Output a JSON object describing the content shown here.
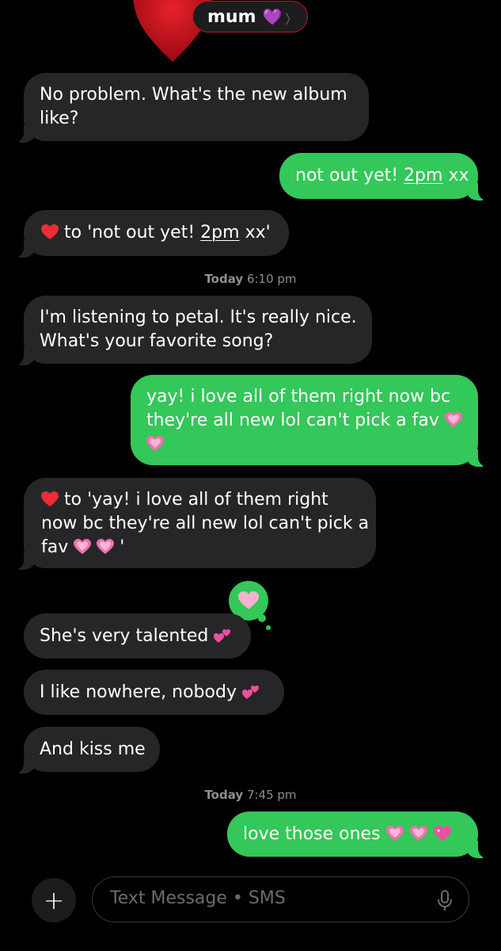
{
  "header": {
    "contact_name": "mum",
    "contact_emoji": "💜",
    "chevron": "〉"
  },
  "messages": [
    {
      "id": "m1",
      "text": "No problem.  What's the new album"
    },
    {
      "id": "m1b",
      "text": "like?"
    },
    {
      "id": "m2",
      "pre": "not out yet! ",
      "link": "2pm",
      "post": " xx"
    },
    {
      "id": "m3",
      "pre": " to 'not out yet! ",
      "link": "2pm",
      "post": " xx'"
    },
    {
      "id": "m4",
      "text": "I'm listening to petal. It's really nice."
    },
    {
      "id": "m4b",
      "text": "What's your favorite song?"
    },
    {
      "id": "m5",
      "text": "yay! i love all of them right now bc"
    },
    {
      "id": "m5b",
      "text": "they're all new lol can't pick a fav"
    },
    {
      "id": "m6",
      "text": " to 'yay! i love all of them right"
    },
    {
      "id": "m6b",
      "text": "now bc they're all new lol can't pick a"
    },
    {
      "id": "m6c",
      "text": "fav"
    },
    {
      "id": "m6d",
      "text": "'"
    },
    {
      "id": "m7",
      "text": "She's very talented"
    },
    {
      "id": "m8",
      "text": "I like nowhere,  nobody"
    },
    {
      "id": "m9",
      "text": "And kiss me"
    },
    {
      "id": "m10",
      "text": "love those ones"
    }
  ],
  "timestamps": [
    {
      "day": "Today",
      "time": "6:10 pm"
    },
    {
      "day": "Today",
      "time": "7:45 pm"
    }
  ],
  "input": {
    "placeholder": "Text Message • SMS",
    "plus": "+"
  },
  "icons": [
    "red-heart-icon",
    "growing-heart-icon",
    "sparkling-heart-icon",
    "two-hearts-icon",
    "microphone-icon",
    "plus-icon"
  ],
  "colors": {
    "sent": "#34c759",
    "received": "#262628",
    "background": "#000000"
  }
}
